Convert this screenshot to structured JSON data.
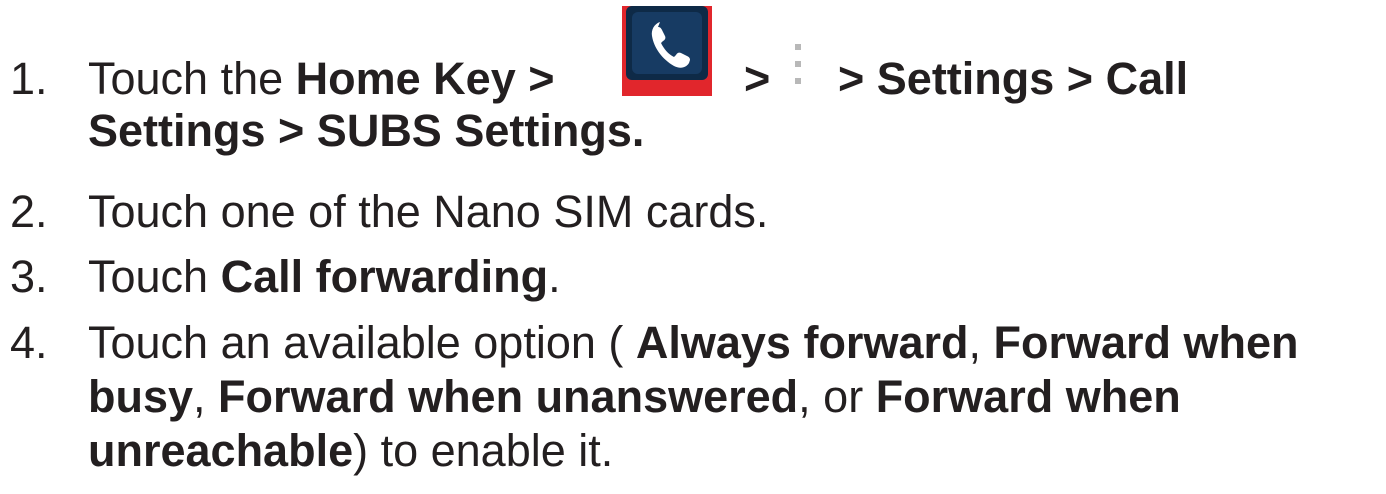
{
  "steps": [
    {
      "number": "1.",
      "parts": {
        "touch": "Touch the ",
        "home_key": "Home Key >",
        "after_phone": ">",
        "after_menu": "> Settings > Call",
        "line2": "Settings > SUBS Settings."
      }
    },
    {
      "number": "2.",
      "text": "Touch one of the Nano SIM cards."
    },
    {
      "number": "3.",
      "parts": {
        "touch": "Touch ",
        "bold": "Call forwarding",
        "end": "."
      }
    },
    {
      "number": "4.",
      "parts": {
        "touch": "Touch an available option ( ",
        "opt1": "Always forward",
        "sep1": ", ",
        "opt2": "Forward when busy",
        "sep2": ", ",
        "opt3": "Forward when unanswered",
        "sep3": ", or ",
        "opt4": "Forward when unreachable",
        "end": ") to enable it."
      }
    }
  ],
  "icons": {
    "phone": "phone-app-icon",
    "menu": "overflow-menu-icon"
  }
}
